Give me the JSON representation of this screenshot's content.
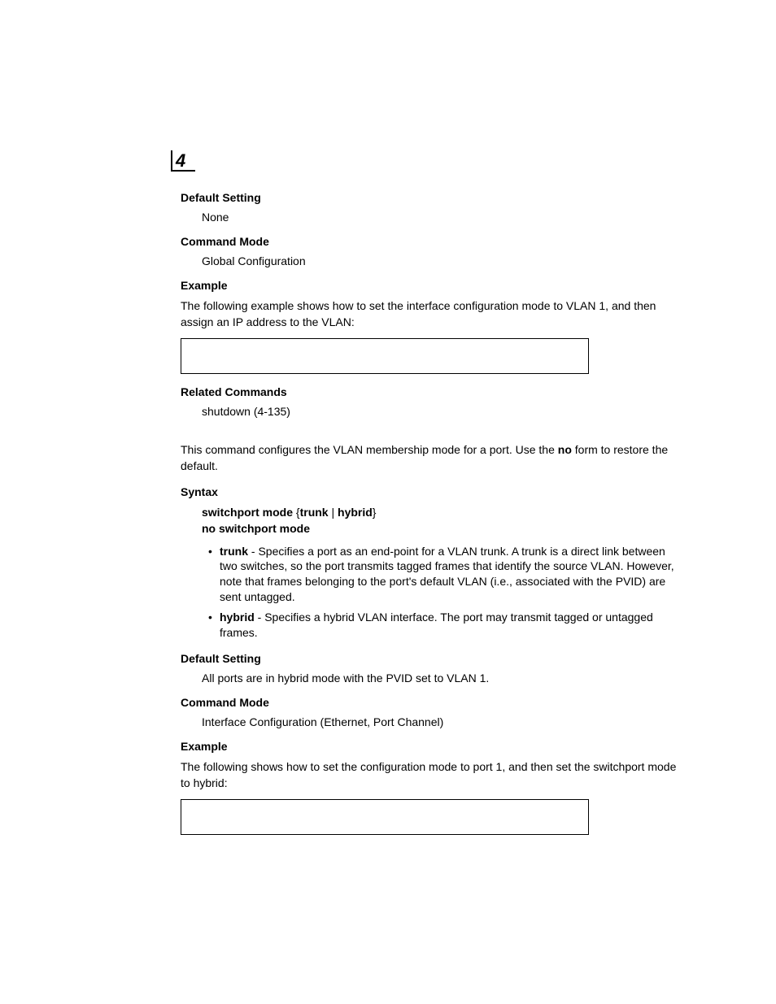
{
  "chapter_number": "4",
  "sections": {
    "default_setting_1": {
      "heading": "Default Setting",
      "text": "None"
    },
    "command_mode_1": {
      "heading": "Command Mode",
      "text": "Global Configuration"
    },
    "example_1": {
      "heading": "Example",
      "text": "The following example shows how to set the interface configuration mode to VLAN 1, and then assign an IP address to the VLAN:"
    },
    "related_commands": {
      "heading": "Related Commands",
      "text": "shutdown (4-135)"
    },
    "intro_2": {
      "text_pre": "This command configures the VLAN membership mode for a port. Use the ",
      "text_bold": "no",
      "text_post": " form to restore the default."
    },
    "syntax": {
      "heading": "Syntax",
      "line1_part1": "switchport mode",
      "line1_brace_open": " {",
      "line1_option1": "trunk",
      "line1_pipe": " | ",
      "line1_option2": "hybrid",
      "line1_brace_close": "}",
      "line2": "no switchport mode",
      "bullets": [
        {
          "term": "trunk",
          "desc": " - Specifies a port as an end-point for a VLAN trunk. A trunk is a direct link between two switches, so the port transmits tagged frames that identify the source VLAN. However, note that frames belonging to the port's default VLAN (i.e., associated with the PVID) are sent untagged."
        },
        {
          "term": "hybrid",
          "desc": " - Specifies a hybrid VLAN interface. The port may transmit tagged or untagged frames."
        }
      ]
    },
    "default_setting_2": {
      "heading": "Default Setting",
      "text": "All ports are in hybrid mode with the PVID set to VLAN 1."
    },
    "command_mode_2": {
      "heading": "Command Mode",
      "text": "Interface Configuration (Ethernet, Port Channel)"
    },
    "example_2": {
      "heading": "Example",
      "text": "The following shows how to set the configuration mode to port 1, and then set the switchport mode to hybrid:"
    }
  }
}
